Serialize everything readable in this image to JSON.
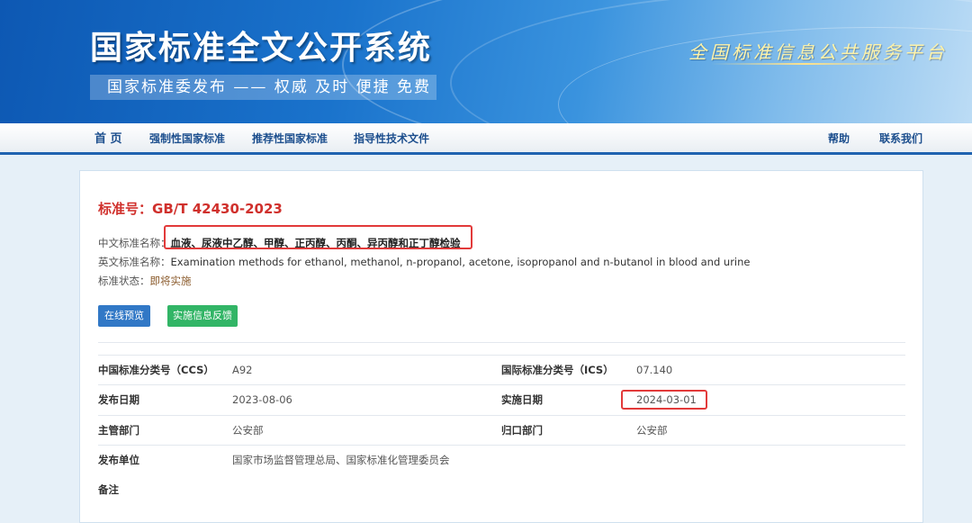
{
  "header": {
    "site_title": "国家标准全文公开系统",
    "slogan": "国家标准委发布 —— 权威 及时 便捷 免费",
    "platform_name": "全国标准信息公共服务平台"
  },
  "nav": {
    "left": [
      "首 页",
      "强制性国家标准",
      "推荐性国家标准",
      "指导性技术文件"
    ],
    "right": [
      "帮助",
      "联系我们"
    ]
  },
  "standard": {
    "number_label": "标准号：",
    "number": "GB/T 42430-2023",
    "cn_name_label": "中文标准名称：",
    "cn_name": "血液、尿液中乙醇、甲醇、正丙醇、丙酮、异丙醇和正丁醇检验",
    "en_name_label": "英文标准名称：",
    "en_name": "Examination methods for ethanol, methanol, n-propanol, acetone, isopropanol and n-butanol in blood and urine",
    "status_label": "标准状态：",
    "status": "即将实施"
  },
  "buttons": {
    "preview": "在线预览",
    "feedback": "实施信息反馈"
  },
  "details": {
    "ccs_label": "中国标准分类号（CCS）",
    "ccs": "A92",
    "ics_label": "国际标准分类号（ICS）",
    "ics": "07.140",
    "publish_date_label": "发布日期",
    "publish_date": "2023-08-06",
    "impl_date_label": "实施日期",
    "impl_date": "2024-03-01",
    "dept_label": "主管部门",
    "dept": "公安部",
    "belong_label": "归口部门",
    "belong": "公安部",
    "publisher_label": "发布单位",
    "publisher": "国家市场监督管理总局、国家标准化管理委员会",
    "remark_label": "备注"
  },
  "colors": {
    "accent_red": "#d0302c",
    "nav_blue": "#1d4f8e",
    "preview_button": "#3178c6",
    "feedback_button": "#32b566",
    "highlight_border": "#e23a3a"
  }
}
